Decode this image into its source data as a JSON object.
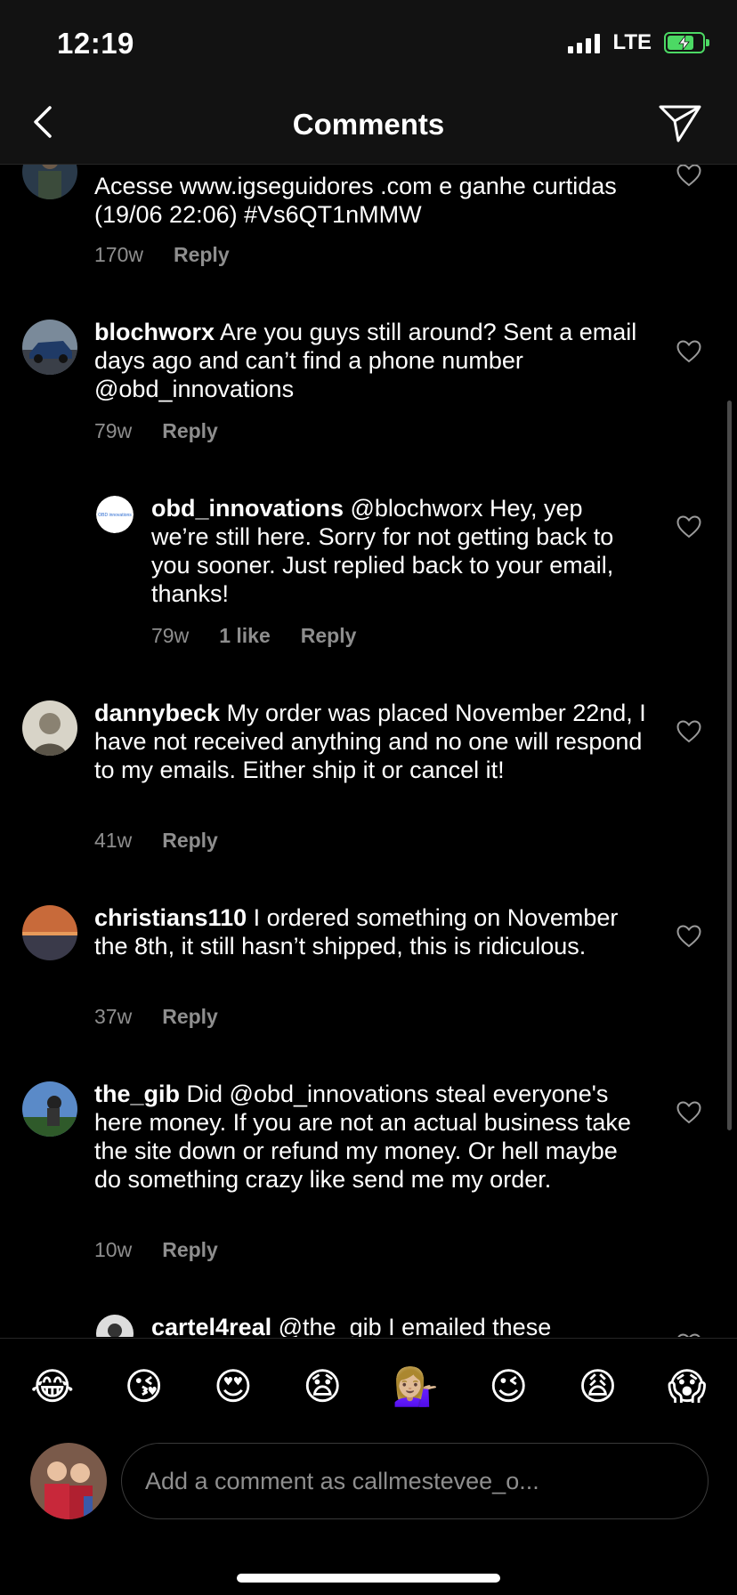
{
  "status_bar": {
    "time": "12:19",
    "network": "LTE"
  },
  "header": {
    "title": "Comments"
  },
  "comments": [
    {
      "text": "Acesse www.igseguidores .com e ganhe curtidas (19/06 22:06) #Vs6QT1nMMW",
      "age": "170w",
      "reply": "Reply"
    },
    {
      "username": "blochworx",
      "text": " Are you guys still around? Sent a email days ago and can’t find a phone number @obd_innovations",
      "age": "79w",
      "reply": "Reply"
    },
    {
      "username": "obd_innovations",
      "text": " @blochworx Hey, yep we’re still here. Sorry for not getting back to you sooner. Just replied back to your email, thanks!",
      "age": "79w",
      "likes": "1 like",
      "reply": "Reply"
    },
    {
      "username": "dannybeck",
      "text": " My order was placed November 22nd, I have not received anything and no one will respond to my emails. Either ship it or cancel it!",
      "age": "41w",
      "reply": "Reply"
    },
    {
      "username": "christians110",
      "text": " I ordered something on November the 8th, it still hasn’t shipped, this is ridiculous.",
      "age": "37w",
      "reply": "Reply"
    },
    {
      "username": "the_gib",
      "text": " Did @obd_innovations steal everyone's here money. If you are not an actual business take the site down or refund my money. Or hell maybe do something crazy like send me my order.",
      "age": "10w",
      "reply": "Reply"
    },
    {
      "username": "cartel4real",
      "text": " @the_gib I emailed these"
    }
  ],
  "emoji_bar": [
    "😂",
    "😘",
    "😍",
    "😧",
    "💁🏼‍♀️",
    "😉",
    "😩",
    "😱"
  ],
  "composer": {
    "placeholder": "Add a comment as callmestevee_o..."
  },
  "colors": {
    "background": "#000000",
    "header": "#121212",
    "muted_text": "#8e8e8e",
    "battery": "#4cd964"
  }
}
